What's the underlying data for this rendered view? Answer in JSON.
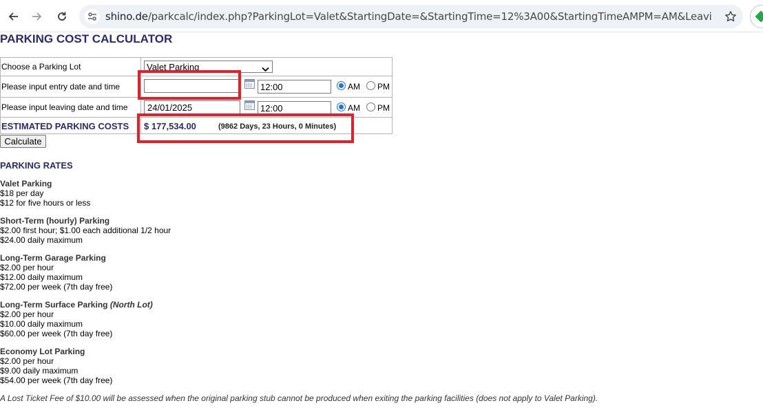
{
  "browser": {
    "url_host": "shino.de",
    "url_path": "/parkcalc/index.php?ParkingLot=Valet&StartingDate=&StartingTime=12%3A00&StartingTimeAMPM=AM&LeavingDate=24%2F01%..."
  },
  "page": {
    "title": "PARKING COST CALCULATOR"
  },
  "form": {
    "lot_label": "Choose a Parking Lot",
    "lot_value": "Valet Parking",
    "entry_label": "Please input entry date and time",
    "entry_date": "",
    "entry_time": "12:00",
    "leaving_label": "Please input leaving date and time",
    "leaving_date": "24/01/2025",
    "leaving_time": "12:00",
    "am_label": "AM",
    "pm_label": "PM",
    "cost_label": "ESTIMATED PARKING COSTS",
    "cost_value": "$ 177,534.00",
    "duration": "(9862 Days, 23 Hours, 0 Minutes)",
    "calculate_label": "Calculate"
  },
  "rates": {
    "title": "PARKING RATES",
    "valet": {
      "name": "Valet Parking",
      "l1": "$18 per day",
      "l2": "$12 for five hours or less"
    },
    "short_term": {
      "name": "Short-Term (hourly) Parking",
      "l1": "$2.00 first hour; $1.00 each additional 1/2 hour",
      "l2": "$24.00 daily maximum"
    },
    "garage": {
      "name": "Long-Term Garage Parking",
      "l1": "$2.00 per hour",
      "l2": "$12.00 daily maximum",
      "l3": "$72.00 per week (7th day free)"
    },
    "surface": {
      "name": "Long-Term Surface Parking",
      "name_em": "(North Lot)",
      "l1": "$2.00 per hour",
      "l2": "$10.00 daily maximum",
      "l3": "$60.00 per week (7th day free)"
    },
    "economy": {
      "name": "Economy Lot Parking",
      "l1": "$2.00 per hour",
      "l2": "$9.00 daily maximum",
      "l3": "$54.00 per week (7th day free)"
    },
    "lost_ticket": "A Lost Ticket Fee of $10.00 will be assessed when the original parking stub cannot be produced when exiting the parking facilities (does not apply to Valet Parking)."
  },
  "colors": {
    "heading": "#2a2a6e",
    "highlight": "#e0202a",
    "radio_checked": "#1a73e8"
  }
}
